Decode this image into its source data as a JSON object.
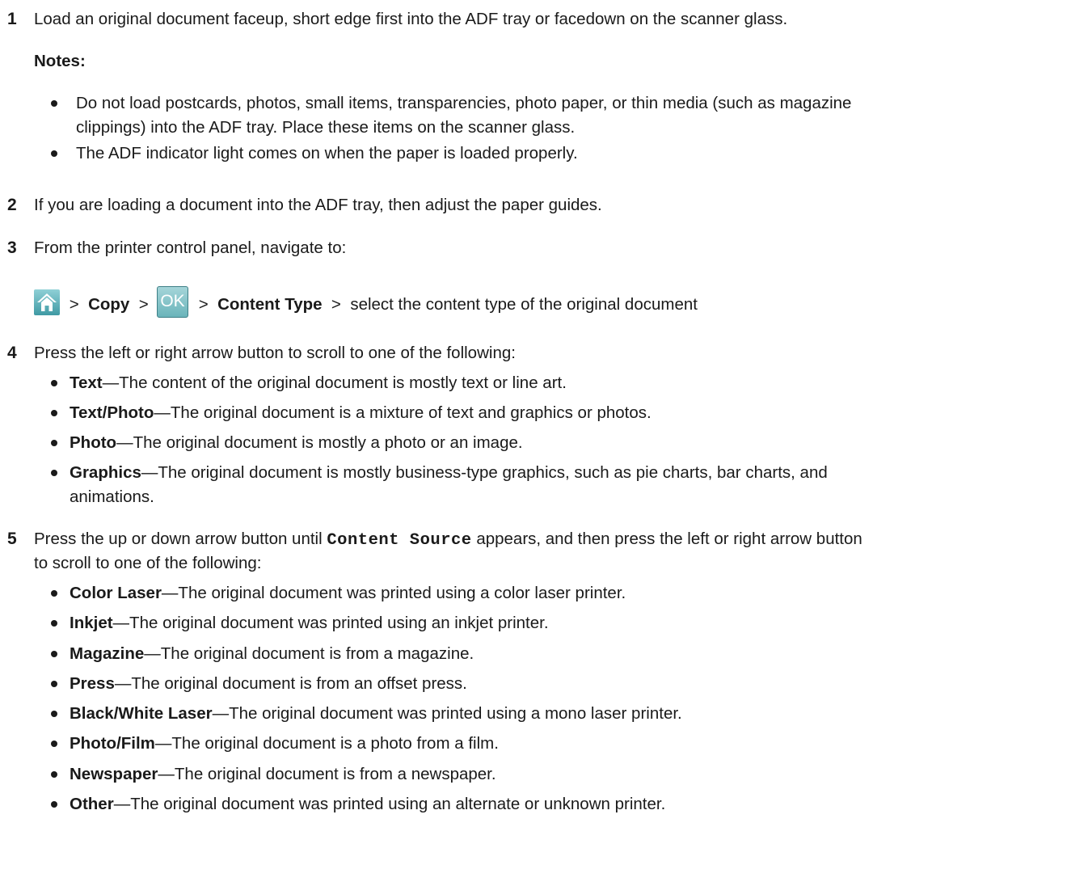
{
  "steps": {
    "s1": {
      "num": "1",
      "text": "Load an original document faceup, short edge first into the ADF tray or facedown on the scanner glass.",
      "notes_label": "Notes:",
      "note1_line1": "Do not load postcards, photos, small items, transparencies, photo paper, or thin media (such as magazine",
      "note1_line2": "clippings) into the ADF tray. Place these items on the scanner glass.",
      "note2": "The ADF indicator light comes on when the paper is loaded properly."
    },
    "s2": {
      "num": "2",
      "text": "If you are loading a document into the ADF tray, then adjust the paper guides."
    },
    "s3": {
      "num": "3",
      "text": "From the printer control panel, navigate to:",
      "nav": {
        "sep": ">",
        "copy": "Copy",
        "ok_label": "OK",
        "content_type": "Content Type",
        "rest": "select the content type of the original document"
      }
    },
    "s4": {
      "num": "4",
      "text": "Press the left or right arrow button to scroll to one of the following:",
      "dash": "—",
      "items": [
        {
          "term": "Text",
          "desc": "The content of the original document is mostly text or line art."
        },
        {
          "term": "Text/Photo",
          "desc": "The original document is a mixture of text and graphics or photos."
        },
        {
          "term": "Photo",
          "desc": "The original document is mostly a photo or an image."
        },
        {
          "term": "Graphics",
          "desc": "The original document is mostly business-type graphics, such as pie charts, bar charts, and",
          "desc2": "animations."
        }
      ]
    },
    "s5": {
      "num": "5",
      "text_pre": "Press the up or down arrow button until",
      "code": "Content Source",
      "text_post": "appears, and then press the left or right arrow button",
      "text_line2": "to scroll to one of the following:",
      "dash": "—",
      "items": [
        {
          "term": "Color Laser",
          "desc": "The original document was printed using a color laser printer."
        },
        {
          "term": "Inkjet",
          "desc": "The original document was printed using an inkjet printer."
        },
        {
          "term": "Magazine",
          "desc": "The original document is from a magazine."
        },
        {
          "term": "Press",
          "desc": "The original document is from an offset press."
        },
        {
          "term": "Black/White Laser",
          "desc": "The original document was printed using a mono laser printer."
        },
        {
          "term": "Photo/Film",
          "desc": "The original document is a photo from a film."
        },
        {
          "term": "Newspaper",
          "desc": "The original document is from a newspaper."
        },
        {
          "term": "Other",
          "desc": "The original document was printed using an alternate or unknown printer."
        }
      ]
    }
  },
  "icons": {
    "home": "home-icon",
    "bullet": "bullet-icon"
  },
  "colors": {
    "home_icon": "#4aa6b0",
    "ok_button": "#7cc0c5"
  }
}
